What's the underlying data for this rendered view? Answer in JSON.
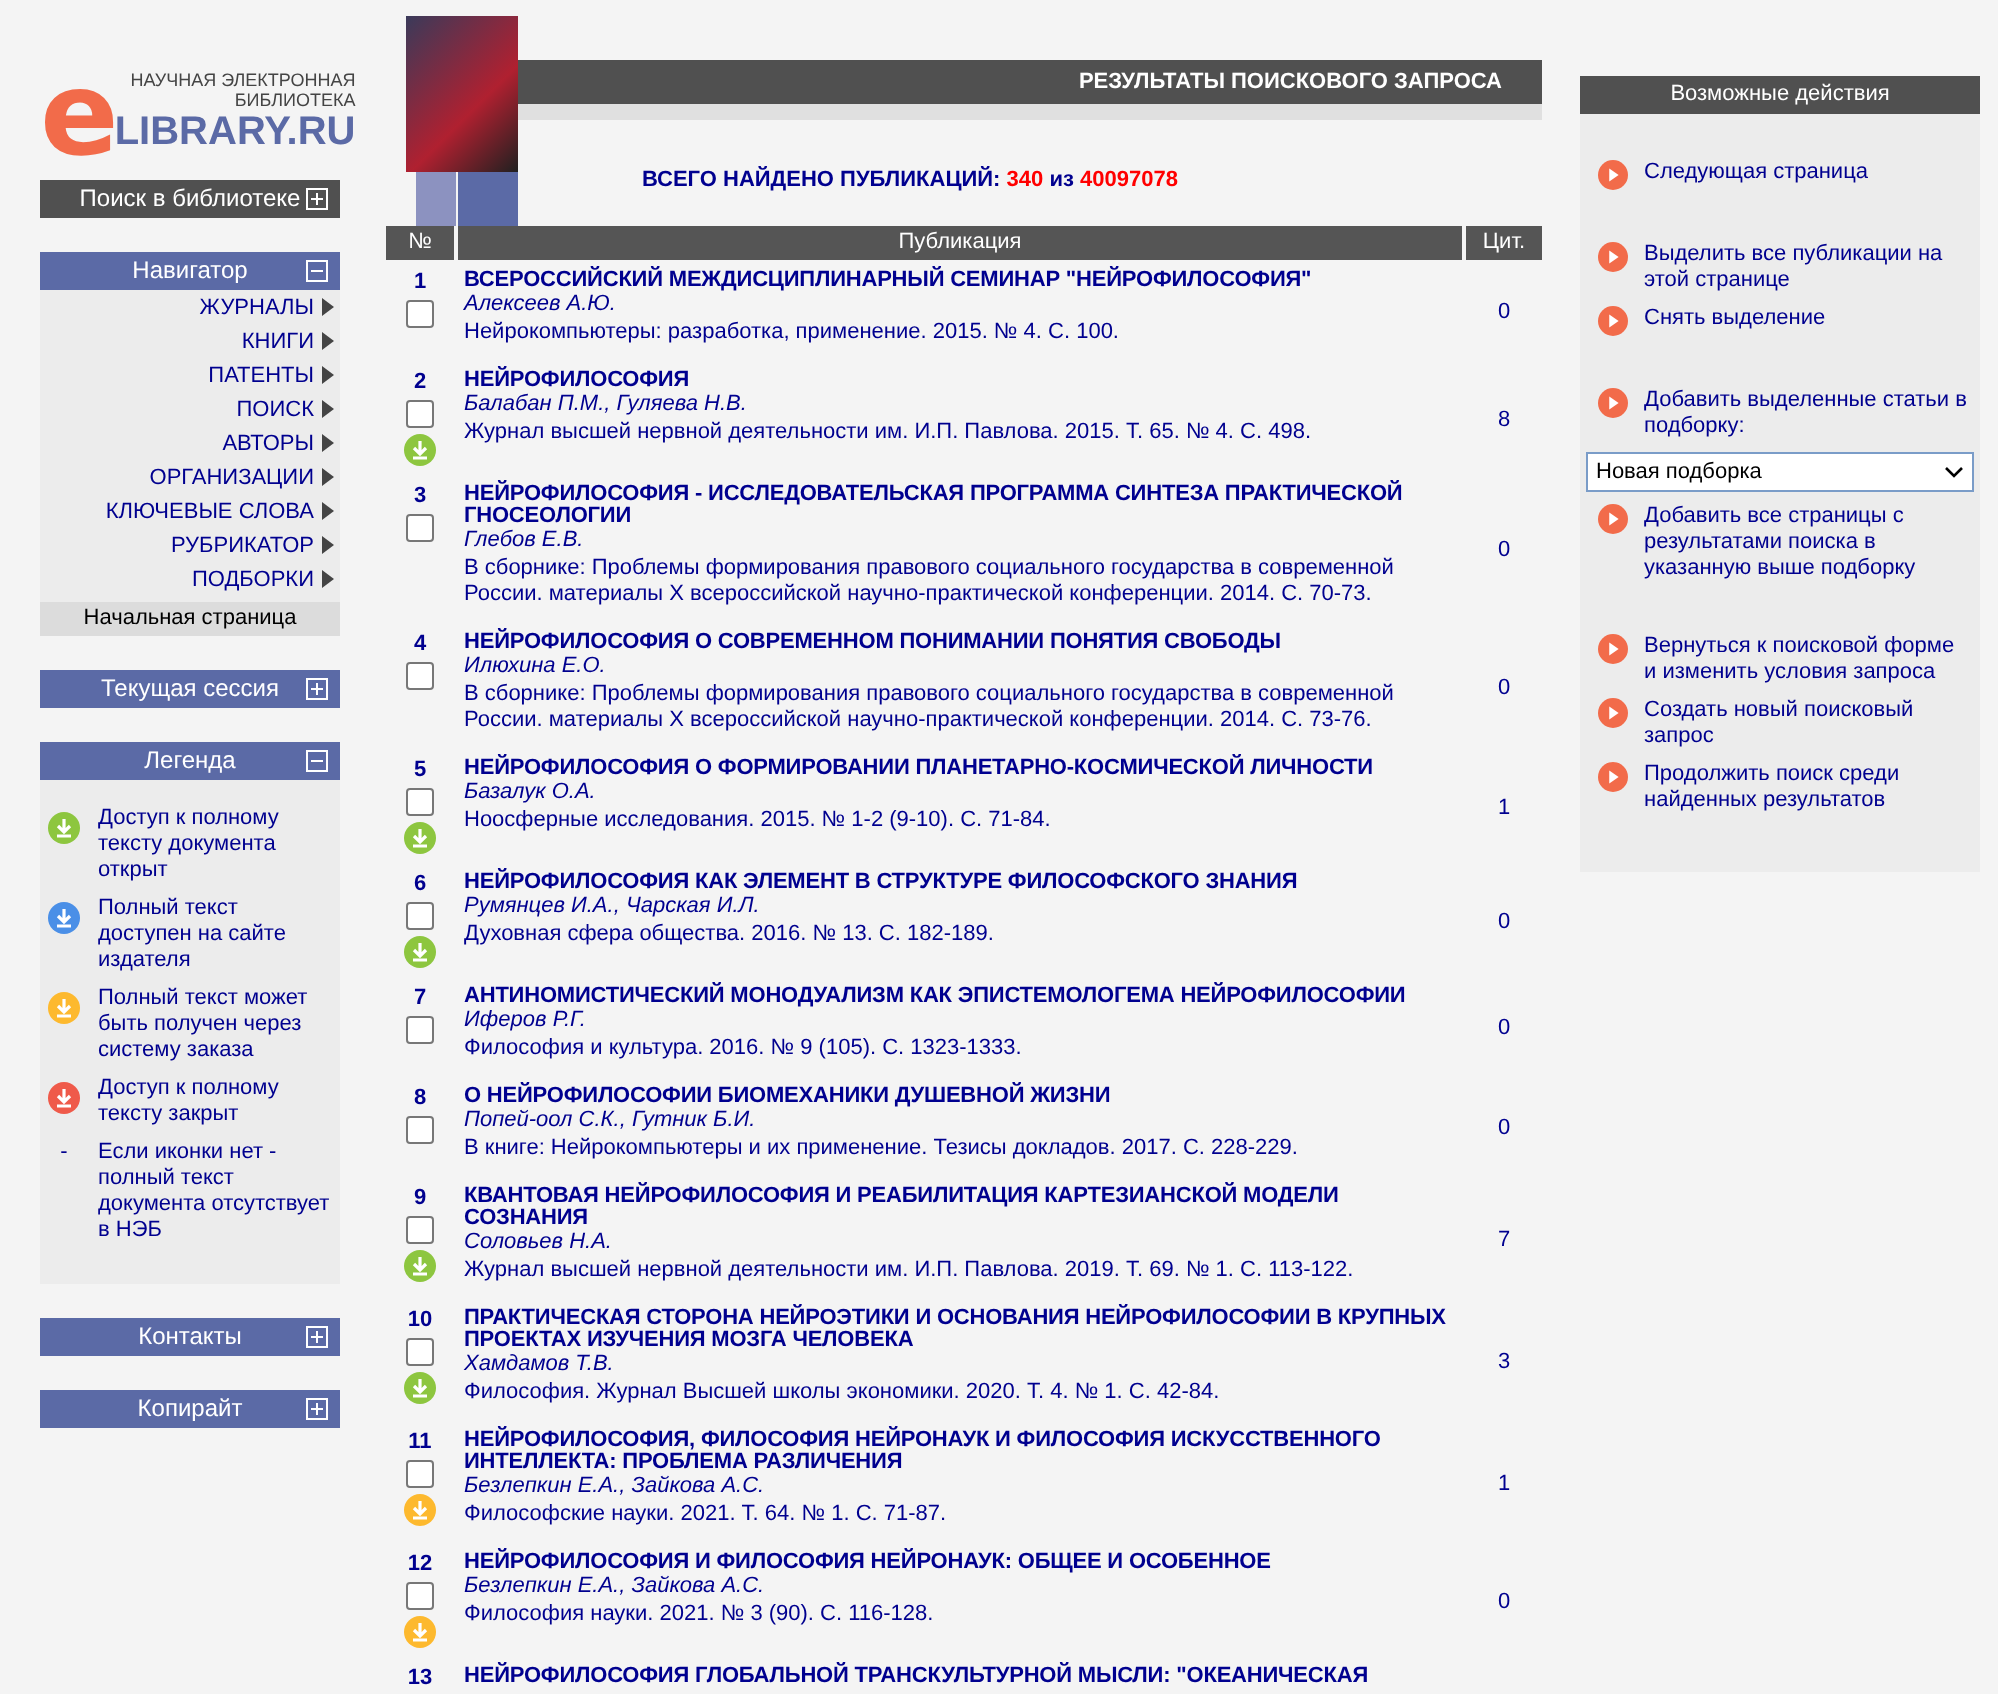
{
  "logo": {
    "mark": "e",
    "tagline_1": "НАУЧНАЯ ЭЛЕКТРОННАЯ",
    "tagline_2": "БИБЛИОТЕКА",
    "name": "LIBRARY.RU"
  },
  "sidebar": {
    "sections": [
      {
        "title": "Поиск в библиотеке",
        "kind": "dark",
        "expanded": false
      },
      {
        "title": "Навигатор",
        "kind": "blue",
        "expanded": true,
        "items": [
          "ЖУРНАЛЫ",
          "КНИГИ",
          "ПАТЕНТЫ",
          "ПОИСК",
          "АВТОРЫ",
          "ОРГАНИЗАЦИИ",
          "КЛЮЧЕВЫЕ СЛОВА",
          "РУБРИКАТОР",
          "ПОДБОРКИ"
        ],
        "home": "Начальная страница"
      },
      {
        "title": "Текущая сессия",
        "kind": "blue",
        "expanded": false
      },
      {
        "title": "Легенда",
        "kind": "blue",
        "expanded": true,
        "legend": [
          {
            "color": "#8dc63f",
            "text": "Доступ к полному тексту документа открыт"
          },
          {
            "color": "#4a8fe7",
            "text": "Полный текст доступен на сайте издателя"
          },
          {
            "color": "#fdb92e",
            "text": "Полный текст может быть получен через систему заказа"
          },
          {
            "color": "#ef5a4a",
            "text": "Доступ к полному тексту закрыт"
          },
          {
            "marker": "-",
            "text": "Если иконки нет - полный текст документа отсутствует в НЭБ"
          }
        ]
      },
      {
        "title": "Контакты",
        "kind": "blue",
        "expanded": false
      },
      {
        "title": "Копирайт",
        "kind": "blue",
        "expanded": false
      }
    ]
  },
  "main": {
    "title": "РЕЗУЛЬТАТЫ ПОИСКОВОГО ЗАПРОСА",
    "found_label": "ВСЕГО НАЙДЕНО ПУБЛИКАЦИЙ:",
    "found": "340",
    "found_of": "из",
    "total": "40097078",
    "table": {
      "columns": [
        "№",
        "Публикация",
        "Цит."
      ],
      "rows": [
        {
          "n": "1",
          "title": "ВСЕРОССИЙСКИЙ МЕЖДИСЦИПЛИНАРНЫЙ СЕМИНАР \"НЕЙРОФИЛОСОФИЯ\"",
          "authors": "Алексеев А.Ю.",
          "source": "Нейрокомпьютеры: разработка, применение. 2015. № 4. С. 100.",
          "cited": "0",
          "checked": false
        },
        {
          "n": "2",
          "title": "НЕЙРОФИЛОСОФИЯ",
          "authors": "Балабан П.М., Гуляева Н.В.",
          "source": "Журнал высшей нервной деятельности им. И.П. Павлова. 2015. Т. 65. № 4. С. 498.",
          "cited": "8",
          "checked": false,
          "color": "#8dc63f"
        },
        {
          "n": "3",
          "title": "НЕЙРОФИЛОСОФИЯ - ИССЛЕДОВАТЕЛЬСКАЯ ПРОГРАММА СИНТЕЗА ПРАКТИЧЕСКОЙ ГНОСЕОЛОГИИ",
          "authors": "Глебов Е.В.",
          "source": "В сборнике: Проблемы формирования правового социального государства в современной России. материалы X всероссийской научно-практической конференции. 2014. С. 70-73.",
          "cited": "0",
          "checked": false
        },
        {
          "n": "4",
          "title": "НЕЙРОФИЛОСОФИЯ О СОВРЕМЕННОМ ПОНИМАНИИ ПОНЯТИЯ СВОБОДЫ",
          "authors": "Илюхина Е.О.",
          "source": "В сборнике: Проблемы формирования правового социального государства в современной России. материалы X всероссийской научно-практической конференции. 2014. С. 73-76.",
          "cited": "0",
          "checked": false
        },
        {
          "n": "5",
          "title": "НЕЙРОФИЛОСОФИЯ О ФОРМИРОВАНИИ ПЛАНЕТАРНО-КОСМИЧЕСКОЙ ЛИЧНОСТИ",
          "authors": "Базалук О.А.",
          "source": "Ноосферные исследования. 2015. № 1-2 (9-10). С. 71-84.",
          "cited": "1",
          "checked": false,
          "color": "#8dc63f"
        },
        {
          "n": "6",
          "title": "НЕЙРОФИЛОСОФИЯ КАК ЭЛЕМЕНТ В СТРУКТУРЕ ФИЛОСОФСКОГО ЗНАНИЯ",
          "authors": "Румянцев И.А., Чарская И.Л.",
          "source": "Духовная сфера общества. 2016. № 13. С. 182-189.",
          "cited": "0",
          "checked": false,
          "color": "#8dc63f"
        },
        {
          "n": "7",
          "title": "АНТИНОМИСТИЧЕСКИЙ МОНОДУАЛИЗМ КАК ЭПИСТЕМОЛОГЕМА НЕЙРОФИЛОСОФИИ",
          "authors": "Иферов Р.Г.",
          "source": "Философия и культура. 2016. № 9 (105). С. 1323-1333.",
          "cited": "0",
          "checked": false
        },
        {
          "n": "8",
          "title": "О НЕЙРОФИЛОСОФИИ БИОМЕХАНИКИ ДУШЕВНОЙ ЖИЗНИ",
          "authors": "Попей-оол С.К., Гутник Б.И.",
          "source": "В книге: Нейрокомпьютеры и их применение. Тезисы докладов. 2017. С. 228-229.",
          "cited": "0",
          "checked": false
        },
        {
          "n": "9",
          "title": "КВАНТОВАЯ НЕЙРОФИЛОСОФИЯ И РЕАБИЛИТАЦИЯ КАРТЕЗИАНСКОЙ МОДЕЛИ СОЗНАНИЯ",
          "authors": "Соловьев Н.А.",
          "source": "Журнал высшей нервной деятельности им. И.П. Павлова. 2019. Т. 69. № 1. С. 113-122.",
          "cited": "7",
          "checked": false,
          "color": "#8dc63f"
        },
        {
          "n": "10",
          "title": "ПРАКТИЧЕСКАЯ СТОРОНА НЕЙРОЭТИКИ И ОСНОВАНИЯ НЕЙРОФИЛОСОФИИ В КРУПНЫХ ПРОЕКТАХ ИЗУЧЕНИЯ МОЗГА ЧЕЛОВЕКА",
          "authors": "Хамдамов Т.В.",
          "source": "Философия. Журнал Высшей школы экономики. 2020. Т. 4. № 1. С. 42-84.",
          "cited": "3",
          "checked": false,
          "color": "#8dc63f"
        },
        {
          "n": "11",
          "title": "НЕЙРОФИЛОСОФИЯ, ФИЛОСОФИЯ НЕЙРОНАУК И ФИЛОСОФИЯ ИСКУССТВЕННОГО ИНТЕЛЛЕКТА: ПРОБЛЕМА РАЗЛИЧЕНИЯ",
          "authors": "Безлепкин Е.А., Зайкова А.С.",
          "source": "Философские науки. 2021. Т. 64. № 1. С. 71-87.",
          "cited": "1",
          "checked": false,
          "color": "#fdb92e"
        },
        {
          "n": "12",
          "title": "НЕЙРОФИЛОСОФИЯ И ФИЛОСОФИЯ НЕЙРОНАУК: ОБЩЕЕ И ОСОБЕННОЕ",
          "authors": "Безлепкин Е.А., Зайкова А.С.",
          "source": "Философия науки. 2021. № 3 (90). С. 116-128.",
          "cited": "0",
          "checked": false,
          "color": "#fdb92e"
        },
        {
          "n": "13",
          "title": "НЕЙРОФИЛОСОФИЯ ГЛОБАЛЬНОЙ ТРАНСКУЛЬТУРНОЙ МЫСЛИ: \"ОКЕАНИЧЕСКАЯ"
        }
      ]
    }
  },
  "actions": {
    "title": "Возможные действия",
    "groups": [
      [
        {
          "kind": "link",
          "text": "Следующая страница"
        }
      ],
      [
        {
          "kind": "link",
          "text": "Выделить все публикации на этой странице"
        },
        {
          "kind": "link",
          "text": "Снять выделение"
        }
      ],
      [
        {
          "kind": "link",
          "text": "Добавить выделенные статьи в подборку:"
        },
        {
          "kind": "select",
          "text": "Новая подборка"
        },
        {
          "kind": "link",
          "text": "Добавить все страницы с результатами поиска в указанную выше подборку"
        }
      ],
      [
        {
          "kind": "link",
          "text": "Вернуться к поисковой форме и изменить условия запроса"
        },
        {
          "kind": "link",
          "text": "Создать новый поисковый запрос"
        },
        {
          "kind": "link",
          "text": "Продолжить поиск среди найденных результатов"
        }
      ]
    ]
  }
}
